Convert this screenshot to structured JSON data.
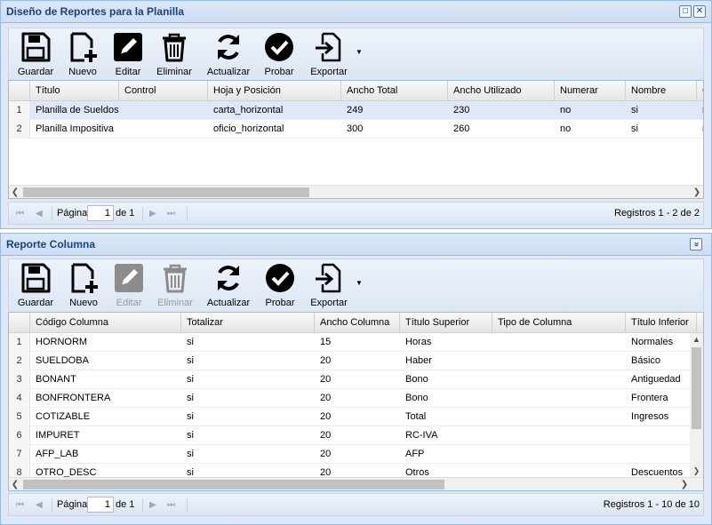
{
  "top": {
    "title": "Diseño de Reportes para la Planilla",
    "header_buttons": {
      "restore": "□",
      "close": "✕"
    },
    "toolbar": [
      {
        "label": "Guardar",
        "icon": "save-icon",
        "enabled": true
      },
      {
        "label": "Nuevo",
        "icon": "new-document-icon",
        "enabled": true
      },
      {
        "label": "Editar",
        "icon": "edit-icon",
        "enabled": true
      },
      {
        "label": "Eliminar",
        "icon": "trash-icon",
        "enabled": true
      },
      {
        "label": "Actualizar",
        "icon": "refresh-icon",
        "enabled": true
      },
      {
        "label": "Probar",
        "icon": "check-circle-icon",
        "enabled": true
      },
      {
        "label": "Exportar",
        "icon": "export-icon",
        "enabled": true
      }
    ],
    "grid": {
      "columns": [
        "Título",
        "Control",
        "Hoja y Posición",
        "Ancho Total",
        "Ancho Utilizado",
        "Numerar",
        "Nombre",
        "C"
      ],
      "rows": [
        {
          "num": "1",
          "cells": [
            "Planilla de Sueldos",
            "",
            "carta_horizontal",
            "249",
            "230",
            "no",
            "si",
            "n"
          ]
        },
        {
          "num": "2",
          "cells": [
            "Planilla Impositiva",
            "",
            "oficio_horizontal",
            "300",
            "260",
            "no",
            "si",
            "n"
          ]
        }
      ]
    },
    "pager": {
      "page_label": "Página",
      "page_value": "1",
      "of_label": "de 1",
      "info": "Registros 1 - 2 de 2"
    }
  },
  "bottom": {
    "title": "Reporte Columna",
    "header_buttons": {
      "collapse": "»"
    },
    "toolbar": [
      {
        "label": "Guardar",
        "icon": "save-icon",
        "enabled": true
      },
      {
        "label": "Nuevo",
        "icon": "new-document-icon",
        "enabled": true
      },
      {
        "label": "Editar",
        "icon": "edit-icon",
        "enabled": false
      },
      {
        "label": "Eliminar",
        "icon": "trash-icon",
        "enabled": false
      },
      {
        "label": "Actualizar",
        "icon": "refresh-icon",
        "enabled": true
      },
      {
        "label": "Probar",
        "icon": "check-circle-icon",
        "enabled": true
      },
      {
        "label": "Exportar",
        "icon": "export-icon",
        "enabled": true
      }
    ],
    "grid": {
      "columns": [
        "Código Columna",
        "Totalizar",
        "Ancho Columna",
        "Título Superior",
        "Tipo de Columna",
        "Título Inferior"
      ],
      "rows": [
        {
          "num": "1",
          "cells": [
            "HORNORM",
            "si",
            "15",
            "Horas",
            "",
            "Normales"
          ]
        },
        {
          "num": "2",
          "cells": [
            "SUELDOBA",
            "si",
            "20",
            "Haber",
            "",
            "Básico"
          ]
        },
        {
          "num": "3",
          "cells": [
            "BONANT",
            "si",
            "20",
            "Bono",
            "",
            "Antiguedad"
          ]
        },
        {
          "num": "4",
          "cells": [
            "BONFRONTERA",
            "si",
            "20",
            "Bono",
            "",
            "Frontera"
          ]
        },
        {
          "num": "5",
          "cells": [
            "COTIZABLE",
            "si",
            "20",
            "Total",
            "",
            "Ingresos"
          ]
        },
        {
          "num": "6",
          "cells": [
            "IMPURET",
            "si",
            "20",
            "RC-IVA",
            "",
            ""
          ]
        },
        {
          "num": "7",
          "cells": [
            "AFP_LAB",
            "si",
            "20",
            "AFP",
            "",
            ""
          ]
        },
        {
          "num": "8",
          "cells": [
            "OTRO_DESC",
            "si",
            "20",
            "Otros",
            "",
            "Descuentos"
          ]
        }
      ]
    },
    "pager": {
      "page_label": "Página",
      "page_value": "1",
      "of_label": "de 1",
      "info": "Registros 1 - 10 de 10"
    }
  },
  "colors": {
    "panel_border": "#99bbe8",
    "title": "#15428b",
    "selected_row": "#dfe8f6"
  }
}
